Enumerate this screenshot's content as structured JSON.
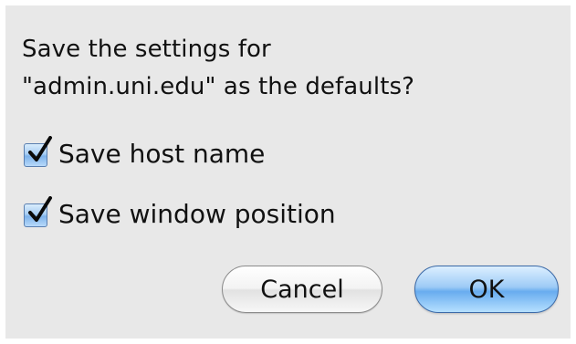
{
  "dialog": {
    "prompt_line1": "Save the settings for",
    "prompt_line2": "\"admin.uni.edu\" as the defaults?",
    "options": [
      {
        "label": "Save host name",
        "checked": true
      },
      {
        "label": "Save window position",
        "checked": true
      }
    ],
    "buttons": {
      "cancel_label": "Cancel",
      "ok_label": "OK"
    }
  },
  "colors": {
    "dialog_background": "#e8e8e8",
    "checkbox_accent": "#7db2ea",
    "checkmark": "#0b0b0b",
    "default_button": "#68acef"
  }
}
